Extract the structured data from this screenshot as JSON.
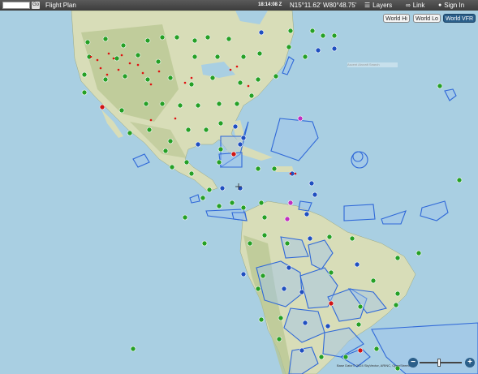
{
  "toolbar": {
    "search_value": "",
    "go_label": "Go",
    "flight_plan_label": "Flight Plan",
    "zulu_time": "18:14:08 Z",
    "coordinates": "N15°11.62' W80°48.75'",
    "layers_label": "Layers",
    "link_label": "Link",
    "sign_in_label": "Sign In"
  },
  "map_type_buttons": [
    {
      "label": "World Hi",
      "active": false
    },
    {
      "label": "World Lo",
      "active": false
    },
    {
      "label": "World VFR",
      "active": true
    }
  ],
  "attribution": "Base Data © 2024 SkyVector, ARINC, OpenStreetMap",
  "ghost_search_text": "Ascent Aircraft Search",
  "zoom": {
    "minus_icon": "zoom-out-icon",
    "plus_icon": "zoom-in-icon",
    "level": 0.45
  },
  "colors": {
    "ocean": "#a9cfe2",
    "land": "#d8ddb8",
    "land_dark": "#b7c48f",
    "airspace_line": "#2f68d8",
    "airspace_fill": "#9ec4ee",
    "marker_green": "#25a025",
    "marker_red": "#d01414",
    "marker_blue": "#1f4fc0",
    "marker_magenta": "#c030c0",
    "accent": "#2b5f8a"
  }
}
